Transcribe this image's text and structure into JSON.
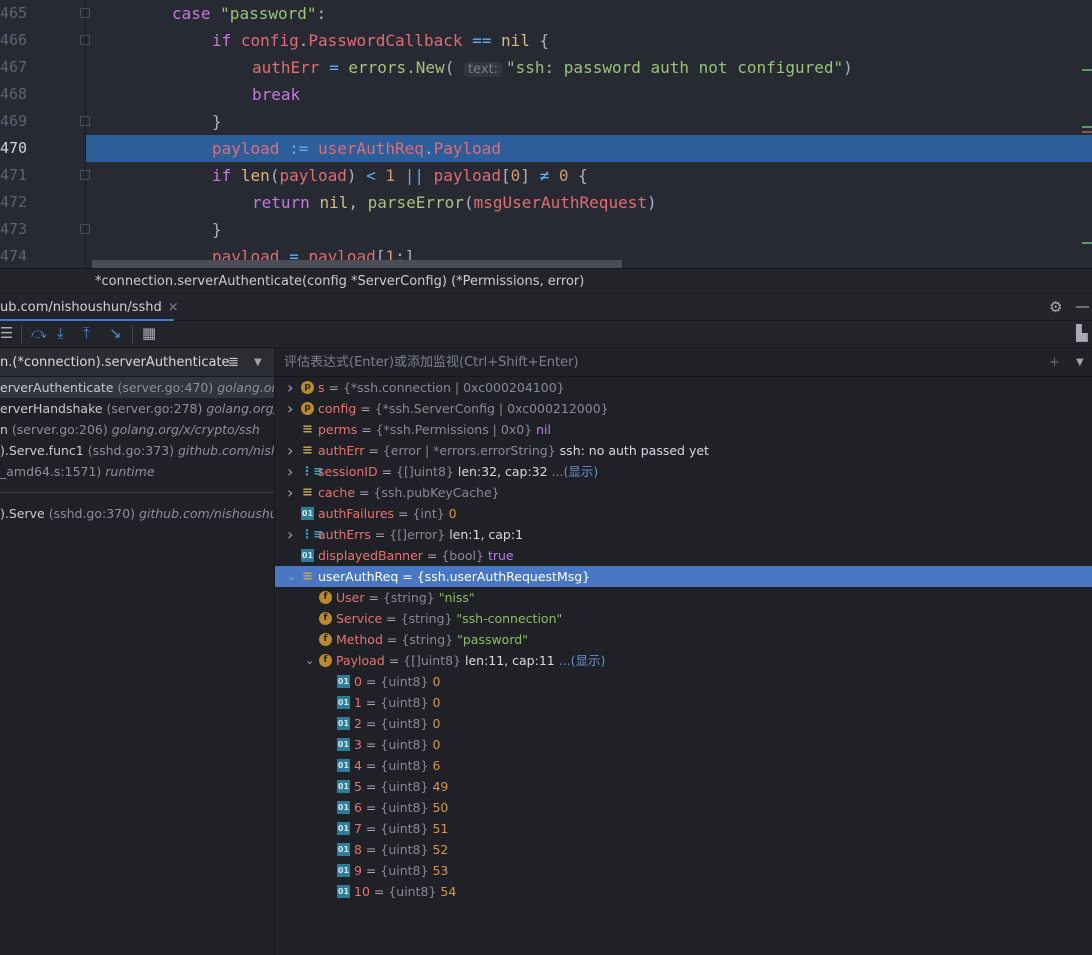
{
  "colors": {
    "accent": "#3d7bd6",
    "current_line": "#2c5f99",
    "selected_var": "#4a77c4"
  },
  "editor": {
    "current_line": "470",
    "lines": [
      {
        "num": "465",
        "indent": 0,
        "fold": true,
        "tokens": [
          [
            "k",
            "case "
          ],
          [
            "s",
            "\"password\""
          ],
          [
            "p",
            ":"
          ]
        ]
      },
      {
        "num": "466",
        "indent": 1,
        "fold": true,
        "tokens": [
          [
            "k",
            "if "
          ],
          [
            "v",
            "config"
          ],
          [
            "p",
            "."
          ],
          [
            "v",
            "PasswordCallback"
          ],
          [
            "o",
            " == "
          ],
          [
            "y",
            "nil "
          ],
          [
            "p",
            "{"
          ]
        ]
      },
      {
        "num": "467",
        "indent": 2,
        "fold": false,
        "tokens": [
          [
            "v",
            "authErr"
          ],
          [
            "o",
            " = "
          ],
          [
            "fn",
            "errors"
          ],
          [
            "p",
            "."
          ],
          [
            "fn",
            "New"
          ],
          [
            "p",
            "( "
          ],
          [
            "hint",
            "text:"
          ],
          [
            "s",
            "\"ssh: password auth not configured\""
          ],
          [
            "p",
            ")"
          ]
        ]
      },
      {
        "num": "468",
        "indent": 2,
        "fold": false,
        "tokens": [
          [
            "k",
            "break"
          ]
        ]
      },
      {
        "num": "469",
        "indent": 1,
        "fold": true,
        "tokens": [
          [
            "p",
            "}"
          ]
        ]
      },
      {
        "num": "470",
        "indent": 1,
        "fold": false,
        "tokens": [
          [
            "v",
            "payload"
          ],
          [
            "o",
            " := "
          ],
          [
            "v",
            "userAuthReq"
          ],
          [
            "p",
            "."
          ],
          [
            "v",
            "Payload"
          ]
        ]
      },
      {
        "num": "471",
        "indent": 1,
        "fold": true,
        "tokens": [
          [
            "k",
            "if "
          ],
          [
            "y",
            "len"
          ],
          [
            "p",
            "("
          ],
          [
            "v",
            "payload"
          ],
          [
            "p",
            ") "
          ],
          [
            "o",
            "< "
          ],
          [
            "n",
            "1 "
          ],
          [
            "o",
            "|| "
          ],
          [
            "v",
            "payload"
          ],
          [
            "p",
            "["
          ],
          [
            "n",
            "0"
          ],
          [
            "p",
            "] "
          ],
          [
            "o",
            "≠ "
          ],
          [
            "n",
            "0 "
          ],
          [
            "p",
            "{"
          ]
        ]
      },
      {
        "num": "472",
        "indent": 2,
        "fold": false,
        "tokens": [
          [
            "k",
            "return "
          ],
          [
            "y",
            "nil"
          ],
          [
            "p",
            ", "
          ],
          [
            "fn",
            "parseError"
          ],
          [
            "p",
            "("
          ],
          [
            "v",
            "msgUserAuthRequest"
          ],
          [
            "p",
            ")"
          ]
        ]
      },
      {
        "num": "473",
        "indent": 1,
        "fold": true,
        "tokens": [
          [
            "p",
            "}"
          ]
        ]
      },
      {
        "num": "474",
        "indent": 1,
        "fold": false,
        "tokens": [
          [
            "v",
            "payload"
          ],
          [
            "o",
            " = "
          ],
          [
            "v",
            "payload"
          ],
          [
            "p",
            "["
          ],
          [
            "n",
            "1"
          ],
          [
            "p",
            ":]"
          ]
        ]
      }
    ]
  },
  "signature": "*connection.serverAuthenticate(config *ServerConfig) (*Permissions, error)",
  "debug_tab": {
    "label": "ub.com/nishoushun/sshd",
    "close": "×"
  },
  "frames": {
    "header": "n.(*connection).serverAuthenticate",
    "items": [
      {
        "name": "erverAuthenticate",
        "loc": "(server.go:470)",
        "pkg": "golang.org/x/",
        "selected": true
      },
      {
        "name": "erverHandshake",
        "loc": "(server.go:278)",
        "pkg": "golang.org/x/cr"
      },
      {
        "name": "n",
        "loc": "(server.go:206)",
        "pkg": "golang.org/x/crypto/ssh"
      },
      {
        "name": ").Serve.func1",
        "loc": "(sshd.go:373)",
        "pkg": "github.com/nishou"
      },
      {
        "name": "",
        "loc": "_amd64.s:1571)",
        "pkg": "runtime"
      }
    ],
    "other": [
      {
        "name": ").Serve",
        "loc": "(sshd.go:370)",
        "pkg": "github.com/nishoushun/"
      }
    ]
  },
  "variables": {
    "placeholder": "评估表达式(Enter)或添加监视(Ctrl+Shift+Enter)",
    "items": [
      {
        "level": 0,
        "arrow": "›",
        "icon": "p",
        "name": "s",
        "type": "{*ssh.connection | 0xc000204100}",
        "value": "",
        "vclass": ""
      },
      {
        "level": 0,
        "arrow": "›",
        "icon": "p",
        "name": "config",
        "type": "{*ssh.ServerConfig | 0xc000212000}",
        "value": "",
        "vclass": ""
      },
      {
        "level": 0,
        "arrow": "",
        "icon": "struct",
        "name": "perms",
        "type": "{*ssh.Permissions | 0x0}",
        "value": "nil",
        "vclass": "vkw"
      },
      {
        "level": 0,
        "arrow": "›",
        "icon": "struct",
        "name": "authErr",
        "type": "{error | *errors.errorString}",
        "value": "ssh: no auth passed yet",
        "vclass": "val"
      },
      {
        "level": 0,
        "arrow": "›",
        "icon": "array",
        "name": "sessionID",
        "type": "{[]uint8}",
        "value": "len:32, cap:32",
        "link": "...(显示)",
        "vclass": "val"
      },
      {
        "level": 0,
        "arrow": "›",
        "icon": "struct",
        "name": "cache",
        "type": "{ssh.pubKeyCache}",
        "value": "",
        "vclass": ""
      },
      {
        "level": 0,
        "arrow": "",
        "icon": "num",
        "name": "authFailures",
        "type": "{int}",
        "value": "0",
        "vclass": "vnum"
      },
      {
        "level": 0,
        "arrow": "›",
        "icon": "array",
        "name": "authErrs",
        "type": "{[]error}",
        "value": "len:1, cap:1",
        "vclass": "val"
      },
      {
        "level": 0,
        "arrow": "",
        "icon": "num",
        "name": "displayedBanner",
        "type": "{bool}",
        "value": "true",
        "vclass": "vkw"
      },
      {
        "level": 0,
        "arrow": "⌄",
        "icon": "struct",
        "name": "userAuthReq",
        "type": "{ssh.userAuthRequestMsg}",
        "value": "",
        "vclass": "",
        "selected": true
      },
      {
        "level": 1,
        "arrow": "",
        "icon": "f",
        "name": "User",
        "type": "{string}",
        "value": "\"niss\"",
        "vclass": "vstr"
      },
      {
        "level": 1,
        "arrow": "",
        "icon": "f",
        "name": "Service",
        "type": "{string}",
        "value": "\"ssh-connection\"",
        "vclass": "vstr"
      },
      {
        "level": 1,
        "arrow": "",
        "icon": "f",
        "name": "Method",
        "type": "{string}",
        "value": "\"password\"",
        "vclass": "vstr"
      },
      {
        "level": 1,
        "arrow": "⌄",
        "icon": "f",
        "name": "Payload",
        "type": "{[]uint8}",
        "value": "len:11, cap:11",
        "link": "...(显示)",
        "vclass": "val"
      },
      {
        "level": 2,
        "arrow": "",
        "icon": "num",
        "name": "0",
        "type": "{uint8}",
        "value": "0",
        "vclass": "vnum"
      },
      {
        "level": 2,
        "arrow": "",
        "icon": "num",
        "name": "1",
        "type": "{uint8}",
        "value": "0",
        "vclass": "vnum"
      },
      {
        "level": 2,
        "arrow": "",
        "icon": "num",
        "name": "2",
        "type": "{uint8}",
        "value": "0",
        "vclass": "vnum"
      },
      {
        "level": 2,
        "arrow": "",
        "icon": "num",
        "name": "3",
        "type": "{uint8}",
        "value": "0",
        "vclass": "vnum"
      },
      {
        "level": 2,
        "arrow": "",
        "icon": "num",
        "name": "4",
        "type": "{uint8}",
        "value": "6",
        "vclass": "vnum"
      },
      {
        "level": 2,
        "arrow": "",
        "icon": "num",
        "name": "5",
        "type": "{uint8}",
        "value": "49",
        "vclass": "vnum"
      },
      {
        "level": 2,
        "arrow": "",
        "icon": "num",
        "name": "6",
        "type": "{uint8}",
        "value": "50",
        "vclass": "vnum"
      },
      {
        "level": 2,
        "arrow": "",
        "icon": "num",
        "name": "7",
        "type": "{uint8}",
        "value": "51",
        "vclass": "vnum"
      },
      {
        "level": 2,
        "arrow": "",
        "icon": "num",
        "name": "8",
        "type": "{uint8}",
        "value": "52",
        "vclass": "vnum"
      },
      {
        "level": 2,
        "arrow": "",
        "icon": "num",
        "name": "9",
        "type": "{uint8}",
        "value": "53",
        "vclass": "vnum"
      },
      {
        "level": 2,
        "arrow": "",
        "icon": "num",
        "name": "10",
        "type": "{uint8}",
        "value": "54",
        "vclass": "vnum"
      }
    ]
  }
}
